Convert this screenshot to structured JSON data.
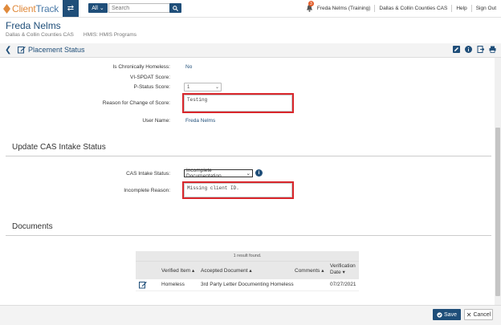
{
  "app": {
    "logo_text_a": "Client",
    "logo_text_b": "Track"
  },
  "search": {
    "scope": "All",
    "placeholder": "Search"
  },
  "nav": {
    "notification_count": "3",
    "user": "Freda Nelms (Training)",
    "org": "Dallas & Collin Counties CAS",
    "help": "Help",
    "sign_out": "Sign Out"
  },
  "client": {
    "name": "Freda Nelms",
    "org": "Dallas & Collin Counties CAS",
    "program": "HMIS: HMIS Programs"
  },
  "page": {
    "title": "Placement Status"
  },
  "form": {
    "chronic_label": "Is Chronically Homeless:",
    "chronic_value": "No",
    "vispdat_label": "VI-SPDAT Score:",
    "pstatus_label": "P-Status Score:",
    "pstatus_value": "1",
    "reason_label": "Reason for Change of Score:",
    "reason_value": "Testing",
    "user_label": "User Name:",
    "user_value": "Freda Nelms"
  },
  "intake": {
    "section_title": "Update CAS Intake Status",
    "status_label": "CAS Intake Status:",
    "status_value": "Incomplete Documentation",
    "reason_label": "Incomplete Reason:",
    "reason_value": "Missing client ID."
  },
  "documents": {
    "section_title": "Documents",
    "result_text": "1 result found.",
    "columns": [
      "Verified Item",
      "Accepted Document",
      "Comments",
      "Verification",
      "Date"
    ],
    "rows": [
      {
        "item": "Homeless",
        "document": "3rd Party Letter Documenting Homeless",
        "comments": "",
        "date": "07/27/2021"
      }
    ]
  },
  "footer": {
    "save": "Save",
    "cancel": "Cancel"
  },
  "colors": {
    "brand": "#1f4e79",
    "accent": "#e08a3c",
    "highlight": "#d9262b"
  }
}
